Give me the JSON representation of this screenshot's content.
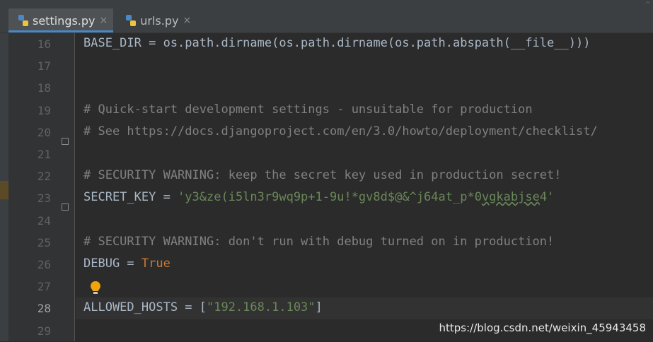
{
  "tabs": [
    {
      "label": "settings.py",
      "active": true
    },
    {
      "label": "urls.py",
      "active": false
    }
  ],
  "lines": [
    {
      "num": "16",
      "parts": [
        {
          "t": "BASE_DIR = os.path.dirname(os.path.dirname(os.path.abspath(__file__)))",
          "c": ""
        }
      ]
    },
    {
      "num": "17",
      "parts": []
    },
    {
      "num": "18",
      "parts": []
    },
    {
      "num": "19",
      "parts": [
        {
          "t": "# Quick-start development settings - unsuitable for production",
          "c": "comment"
        }
      ],
      "fold": true
    },
    {
      "num": "20",
      "parts": [
        {
          "t": "# See https://docs.djangoproject.com/en/3.0/howto/deployment/checklist/",
          "c": "comment"
        }
      ]
    },
    {
      "num": "21",
      "parts": []
    },
    {
      "num": "22",
      "parts": [
        {
          "t": "# SECURITY WARNING: keep the secret key used in production secret!",
          "c": "comment"
        }
      ],
      "fold": true
    },
    {
      "num": "23",
      "parts": [
        {
          "t": "SECRET_KEY = ",
          "c": ""
        },
        {
          "t": "'y3&ze(i5ln3r9wq9p+1-9u!*gv8d$@&^j64at_p*0",
          "c": "str"
        },
        {
          "t": "vgkabjse",
          "c": "str squiggle"
        },
        {
          "t": "4'",
          "c": "str"
        }
      ]
    },
    {
      "num": "24",
      "parts": []
    },
    {
      "num": "25",
      "parts": [
        {
          "t": "# SECURITY WARNING: don't run with debug turned on in production!",
          "c": "comment"
        }
      ]
    },
    {
      "num": "26",
      "parts": [
        {
          "t": "DEBUG = ",
          "c": ""
        },
        {
          "t": "True",
          "c": "kw"
        }
      ]
    },
    {
      "num": "27",
      "parts": []
    },
    {
      "num": "28",
      "parts": [
        {
          "t": "ALLOWED_HOSTS = [",
          "c": ""
        },
        {
          "t": "\"192.168.1.103\"",
          "c": "str"
        },
        {
          "t": "]",
          "c": ""
        }
      ],
      "current": true
    },
    {
      "num": "29",
      "parts": []
    }
  ],
  "watermark": "https://blog.csdn.net/weixin_45943458",
  "colors": {
    "background": "#2b2b2b",
    "comment": "#808080",
    "string": "#6a8759",
    "keyword": "#cc7832",
    "text": "#a9b7c6",
    "tab_accent": "#4a88c7"
  },
  "icons": {
    "tab_file": "python-file-icon",
    "tab_close": "close-icon",
    "hint": "lightbulb-icon",
    "fold": "fold-marker-icon"
  }
}
